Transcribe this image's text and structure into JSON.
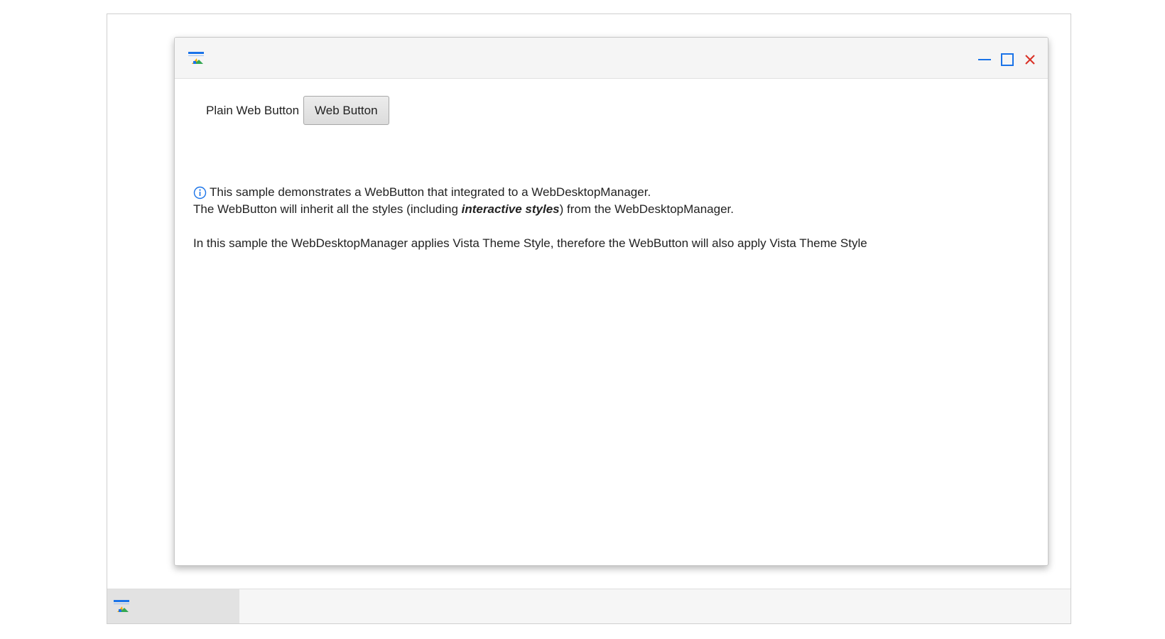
{
  "window": {
    "icon": "app-window-icon",
    "controls": {
      "minimize_icon": "minimize-icon",
      "maximize_icon": "maximize-icon",
      "close_icon": "close-icon"
    }
  },
  "content": {
    "plain_button_label": "Plain Web Button",
    "web_button_label": "Web Button",
    "info_icon": "info-icon",
    "line1": "This sample demonstrates a WebButton that integrated to a WebDesktopManager.",
    "line2_prefix": "The WebButton will inherit all the styles (including ",
    "line2_emphasis": "interactive styles",
    "line2_suffix": ") from the WebDesktopManager.",
    "line3": "In this sample the WebDesktopManager applies Vista Theme Style, therefore the WebButton will also apply Vista Theme Style"
  },
  "taskbar": {
    "items": [
      {
        "icon": "app-window-icon"
      }
    ]
  },
  "colors": {
    "accent_blue": "#1a73e8",
    "close_red": "#d93025",
    "icon_yellow": "#f9ab00",
    "icon_green": "#34a853"
  }
}
